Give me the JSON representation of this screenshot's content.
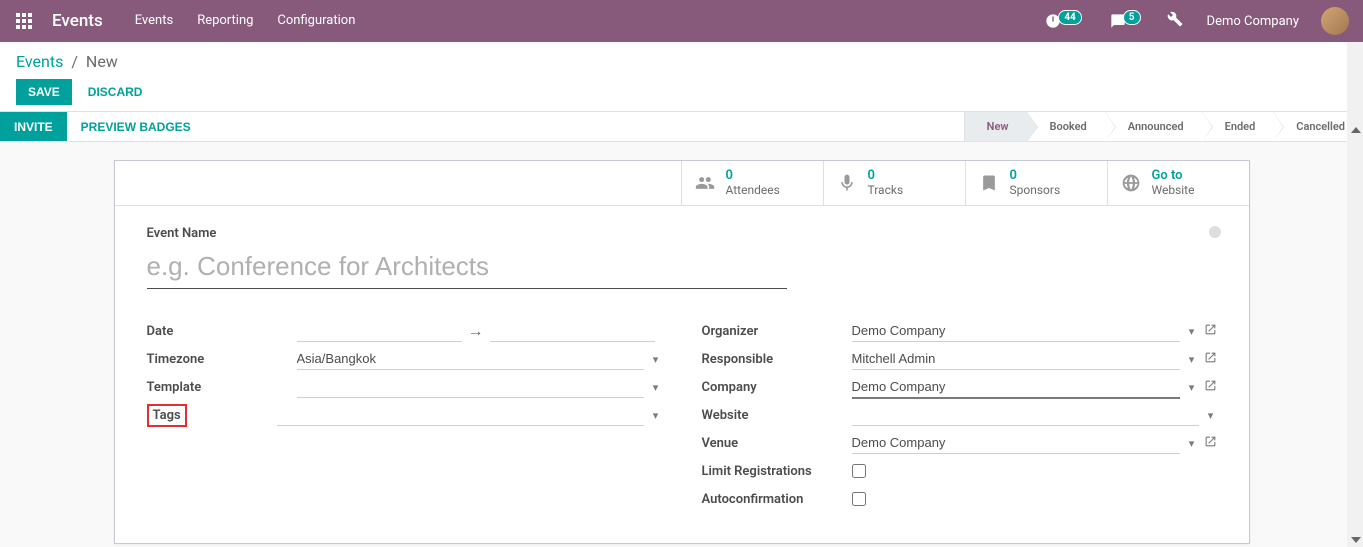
{
  "navbar": {
    "brand": "Events",
    "links": [
      "Events",
      "Reporting",
      "Configuration"
    ],
    "clock_badge": "44",
    "chat_badge": "5",
    "company": "Demo Company"
  },
  "breadcrumb": {
    "root": "Events",
    "current": "New"
  },
  "buttons": {
    "save": "Save",
    "discard": "Discard",
    "invite": "Invite",
    "preview": "Preview Badges"
  },
  "status_steps": [
    "New",
    "Booked",
    "Announced",
    "Ended",
    "Cancelled"
  ],
  "active_step": "New",
  "stat_buttons": [
    {
      "id": "attendees",
      "count": "0",
      "label": "Attendees",
      "icon": "users"
    },
    {
      "id": "tracks",
      "count": "0",
      "label": "Tracks",
      "icon": "mic"
    },
    {
      "id": "sponsors",
      "count": "0",
      "label": "Sponsors",
      "icon": "bookmark"
    },
    {
      "id": "website",
      "count": "Go to",
      "label": "Website",
      "icon": "globe"
    }
  ],
  "form": {
    "name_label": "Event Name",
    "name_placeholder": "e.g. Conference for Architects",
    "left": {
      "date_label": "Date",
      "timezone_label": "Timezone",
      "timezone_value": "Asia/Bangkok",
      "template_label": "Template",
      "tags_label": "Tags"
    },
    "right": {
      "organizer_label": "Organizer",
      "organizer_value": "Demo Company",
      "responsible_label": "Responsible",
      "responsible_value": "Mitchell Admin",
      "company_label": "Company",
      "company_value": "Demo Company",
      "website_label": "Website",
      "venue_label": "Venue",
      "venue_value": "Demo Company",
      "limit_label": "Limit Registrations",
      "autoconfirm_label": "Autoconfirmation"
    }
  }
}
